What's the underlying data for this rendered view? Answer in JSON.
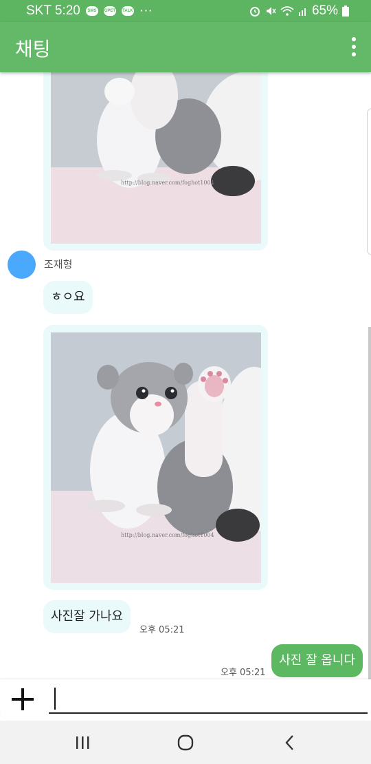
{
  "status_bar": {
    "carrier_time": "SKT 5:20",
    "icons": [
      "sms-icon",
      "gpet-icon",
      "talk-icon",
      "more-dots-icon",
      "alarm-icon",
      "mute-icon",
      "wifi-icon",
      "signal-icon"
    ],
    "gpet_label": "GPET",
    "talk_label": "TALK",
    "battery": "65%"
  },
  "app_bar": {
    "title": "채팅",
    "menu_icon": "more-vert-icon"
  },
  "chat": {
    "messages": [
      {
        "type": "image",
        "direction": "in",
        "watermark": "http://blog.naver.com/foghot1004"
      },
      {
        "type": "sender",
        "name": "조재형"
      },
      {
        "type": "text",
        "direction": "in",
        "text": "ㅎㅇ요"
      },
      {
        "type": "image",
        "direction": "in",
        "watermark": "http://blog.naver.com/foghot1004"
      },
      {
        "type": "text",
        "direction": "in",
        "text": "사진잘 가나요",
        "time": "오후 05:21"
      },
      {
        "type": "text",
        "direction": "out",
        "text": "사진 잘 옵니다",
        "time": "오후 05:21"
      }
    ],
    "sender_name": "조재형",
    "msg_hello": "ㅎㅇ요",
    "msg_photo_question": "사진잘 가나요",
    "msg_photo_question_time": "오후 05:21",
    "msg_photo_answer": "사진 잘 옵니다",
    "msg_photo_answer_time": "오후 05:21",
    "watermark": "http://blog.naver.com/foghot1004"
  },
  "input": {
    "value": "",
    "placeholder": "",
    "attach_icon": "plus-icon"
  },
  "nav": {
    "recent_icon": "recent-apps-icon",
    "home_icon": "home-icon",
    "back_icon": "back-icon"
  },
  "colors": {
    "primary": "#63b968",
    "status_bar": "#5db561",
    "incoming_bubble": "#eafafa",
    "outgoing_bubble": "#5db862",
    "avatar": "#4aa9fd"
  }
}
